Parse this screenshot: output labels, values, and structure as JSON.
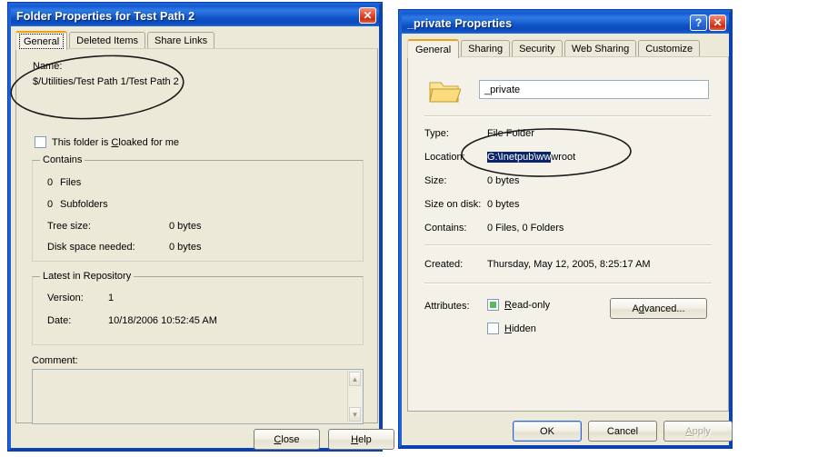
{
  "left_dialog": {
    "title": "Folder Properties for Test Path 2",
    "close_button": "✕",
    "tabs": [
      {
        "label": "General",
        "active": true
      },
      {
        "label": "Deleted Items",
        "active": false
      },
      {
        "label": "Share Links",
        "active": false
      }
    ],
    "name_label": "Name:",
    "name_value": "$/Utilities/Test Path 1/Test Path 2",
    "cloaked_checkbox": {
      "text_before": "This folder is ",
      "accel": "C",
      "text_after": "loaked for me",
      "checked": false
    },
    "contains_group": {
      "legend": "Contains",
      "files_count": "0",
      "files_label": "Files",
      "subfolders_count": "0",
      "subfolders_label": "Subfolders",
      "tree_size_label": "Tree size:",
      "tree_size_value": "0 bytes",
      "disk_space_label": "Disk space needed:",
      "disk_space_value": "0 bytes"
    },
    "latest_group": {
      "legend": "Latest in Repository",
      "version_label": "Version:",
      "version_value": "1",
      "date_label": "Date:",
      "date_value": "10/18/2006 10:52:45 AM"
    },
    "comment_label": "Comment:",
    "comment_value": "",
    "scroll_up_icon": "▲",
    "scroll_down_icon": "▼",
    "buttons": {
      "close_accel": "C",
      "close_rest": "lose",
      "help_accel": "H",
      "help_rest": "elp"
    }
  },
  "right_dialog": {
    "title": "_private Properties",
    "help_button": "?",
    "close_button": "✕",
    "tabs": [
      {
        "label": "General",
        "active": true
      },
      {
        "label": "Sharing",
        "active": false
      },
      {
        "label": "Security",
        "active": false
      },
      {
        "label": "Web Sharing",
        "active": false
      },
      {
        "label": "Customize",
        "active": false
      }
    ],
    "folder_icon": "folder-icon",
    "name_value": "_private",
    "rows": [
      {
        "label": "Type:",
        "value": "File Folder"
      },
      {
        "label": "Size:",
        "value": "0 bytes"
      },
      {
        "label": "Size on disk:",
        "value": "0 bytes"
      },
      {
        "label": "Contains:",
        "value": "0 Files, 0 Folders"
      }
    ],
    "location_label": "Location:",
    "location_selected": "G:\\Inetpub\\ww",
    "location_rest": "wroot",
    "created_label": "Created:",
    "created_value": "Thursday, May 12, 2005, 8:25:17 AM",
    "attributes_label": "Attributes:",
    "readonly_checkbox": {
      "accel": "R",
      "rest": "ead-only",
      "state": "indeterminate",
      "fill_color": "#5cb85c"
    },
    "hidden_checkbox": {
      "accel": "H",
      "rest": "idden",
      "state": "unchecked"
    },
    "advanced_button": {
      "before": "A",
      "accel": "d",
      "after": "vanced..."
    },
    "buttons": {
      "ok": "OK",
      "cancel": "Cancel",
      "apply_accel": "A",
      "apply_rest": "pply",
      "apply_disabled": true,
      "ok_default": true
    }
  },
  "annotations": {
    "left_ellipse": "highlight-name-path",
    "right_ellipse": "highlight-location-path",
    "stroke_color": "#1a1a1a"
  }
}
